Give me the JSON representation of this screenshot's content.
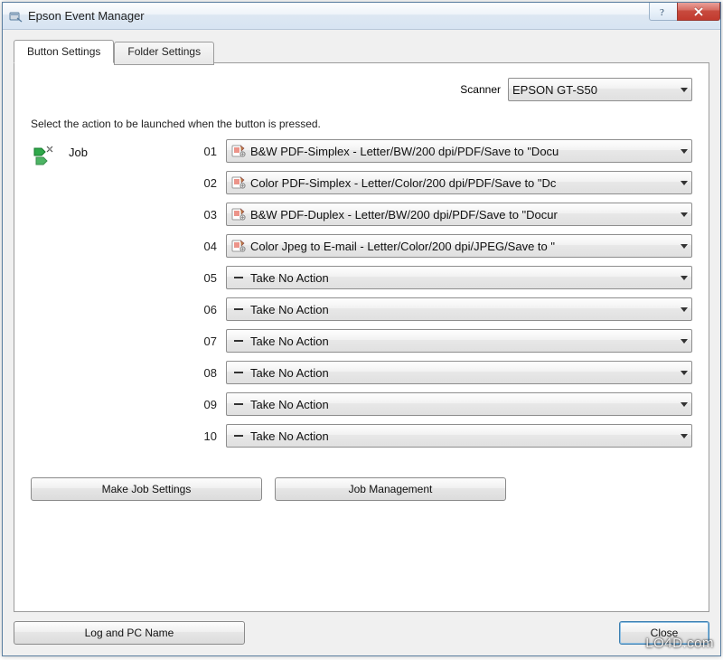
{
  "window": {
    "title": "Epson Event Manager"
  },
  "tabs": {
    "button_settings": "Button Settings",
    "folder_settings": "Folder Settings"
  },
  "scanner": {
    "label": "Scanner",
    "selected": "EPSON GT-S50"
  },
  "instruction": "Select the action to be launched when the button is pressed.",
  "job": {
    "label": "Job",
    "rows": [
      {
        "num": "01",
        "icon": "preset",
        "text": "B&W PDF-Simplex - Letter/BW/200 dpi/PDF/Save to \"Docu"
      },
      {
        "num": "02",
        "icon": "preset",
        "text": "Color PDF-Simplex - Letter/Color/200 dpi/PDF/Save to \"Dc"
      },
      {
        "num": "03",
        "icon": "preset",
        "text": "B&W PDF-Duplex - Letter/BW/200 dpi/PDF/Save to \"Docur"
      },
      {
        "num": "04",
        "icon": "preset",
        "text": "Color Jpeg to E-mail - Letter/Color/200 dpi/JPEG/Save to \""
      },
      {
        "num": "05",
        "icon": "none",
        "text": "Take No Action"
      },
      {
        "num": "06",
        "icon": "none",
        "text": "Take No Action"
      },
      {
        "num": "07",
        "icon": "none",
        "text": "Take No Action"
      },
      {
        "num": "08",
        "icon": "none",
        "text": "Take No Action"
      },
      {
        "num": "09",
        "icon": "none",
        "text": "Take No Action"
      },
      {
        "num": "10",
        "icon": "none",
        "text": "Take No Action"
      }
    ]
  },
  "buttons": {
    "make_job_settings": "Make Job Settings",
    "job_management": "Job Management",
    "log_and_pc_name": "Log and PC Name",
    "close": "Close"
  },
  "watermark": "LO4D.com"
}
